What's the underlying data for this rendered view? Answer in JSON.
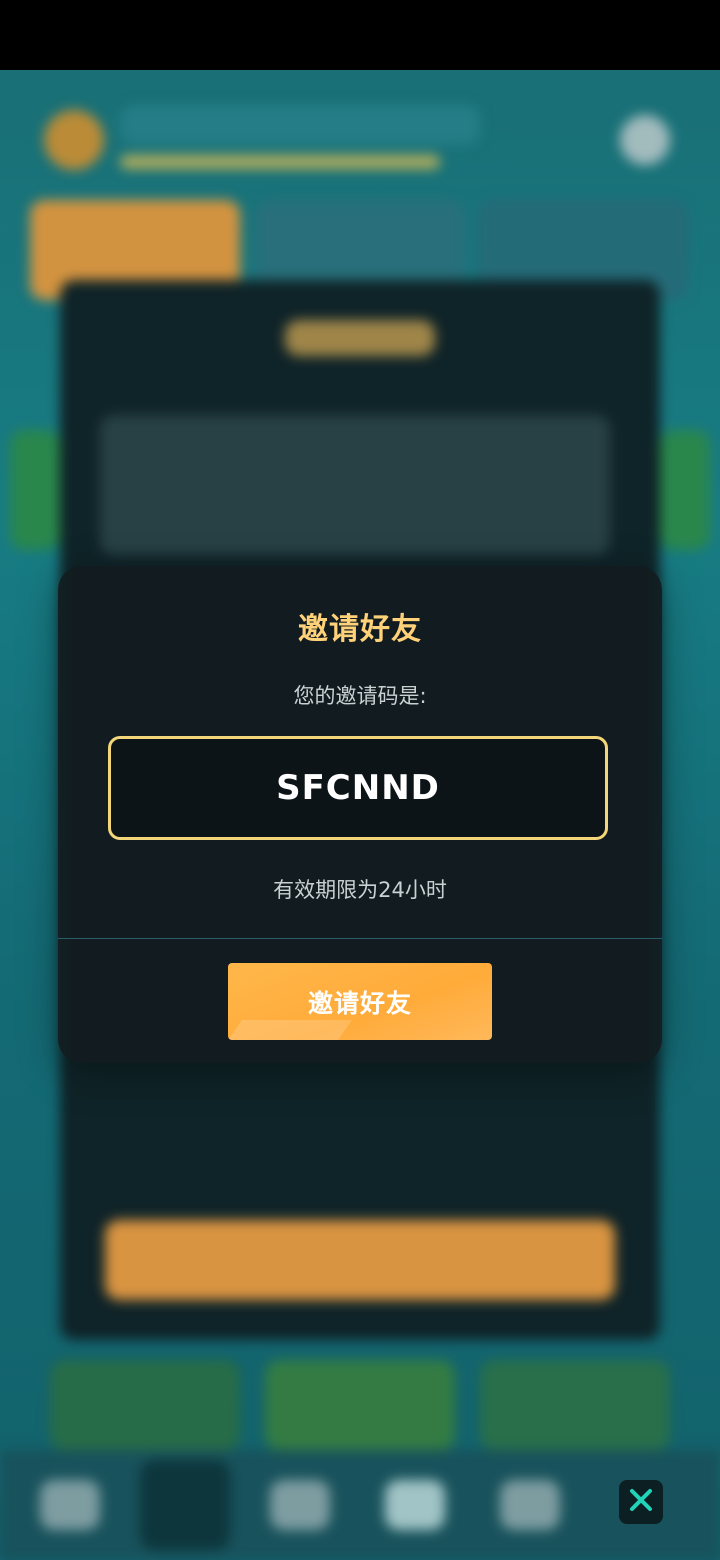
{
  "dialog": {
    "title": "邀请好友",
    "subtitle": "您的邀请码是:",
    "invite_code": "SFCNND",
    "validity": "有效期限为24小时",
    "button_label": "邀请好友"
  },
  "icons": {
    "close": "close-icon"
  },
  "colors": {
    "accent_gold": "#FFD27A",
    "code_border": "#F4D67A",
    "button_orange": "#FFAB3A",
    "close_x": "#21D3B7"
  }
}
